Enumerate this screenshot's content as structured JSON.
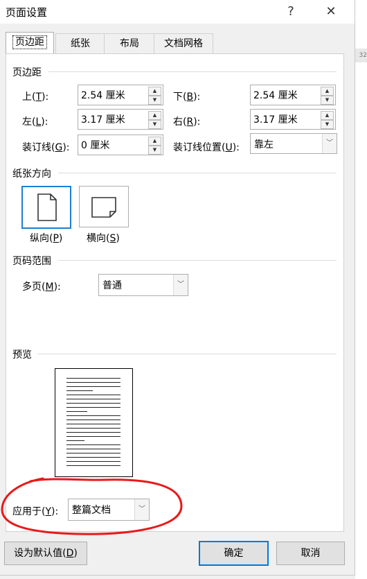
{
  "window": {
    "title": "页面设置",
    "help_glyph": "?",
    "close_glyph": "✕"
  },
  "tabs": [
    {
      "label": "页边距",
      "active": true
    },
    {
      "label": "纸张"
    },
    {
      "label": "布局"
    },
    {
      "label": "文档网格"
    }
  ],
  "margins": {
    "group_title": "页边距",
    "top": {
      "label_pre": "上(",
      "key": "T",
      "label_post": "):",
      "value": "2.54 厘米"
    },
    "bottom": {
      "label_pre": "下(",
      "key": "B",
      "label_post": "):",
      "value": "2.54 厘米"
    },
    "left": {
      "label_pre": "左(",
      "key": "L",
      "label_post": "):",
      "value": "3.17 厘米"
    },
    "right": {
      "label_pre": "右(",
      "key": "R",
      "label_post": "):",
      "value": "3.17 厘米"
    },
    "gutter": {
      "label_pre": "装订线(",
      "key": "G",
      "label_post": "):",
      "value": "0 厘米"
    },
    "gutter_pos": {
      "label_pre": "装订线位置(",
      "key": "U",
      "label_post": "):",
      "value": "靠左"
    }
  },
  "orientation": {
    "group_title": "纸张方向",
    "portrait": {
      "label_pre": "纵向(",
      "key": "P",
      "label_post": ")",
      "selected": true
    },
    "landscape": {
      "label_pre": "横向(",
      "key": "S",
      "label_post": ")"
    }
  },
  "pages": {
    "group_title": "页码范围",
    "multiple": {
      "label_pre": "多页(",
      "key": "M",
      "label_post": "):",
      "value": "普通"
    }
  },
  "preview": {
    "group_title": "预览",
    "apply_to": {
      "label_pre": "应用于(",
      "key": "Y",
      "label_post": "):",
      "value": "整篇文档"
    }
  },
  "buttons": {
    "set_default": {
      "label_pre": "设为默认值(",
      "key": "D",
      "label_post": ")"
    },
    "ok": "确定",
    "cancel": "取消"
  },
  "colors": {
    "annotation_red": "#e8191a",
    "selection_blue": "#1d7fd1",
    "default_button_border": "#0078d7"
  },
  "icons": {
    "spin_up": "up-arrow-icon",
    "spin_down": "down-arrow-icon",
    "dropdown": "chevron-down-icon",
    "portrait": "portrait-page-icon",
    "landscape": "landscape-page-icon"
  },
  "background": {
    "edge_text": "32"
  }
}
